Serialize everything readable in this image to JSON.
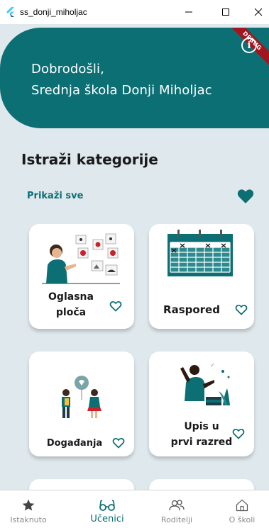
{
  "window": {
    "title": "ss_donji_miholjac"
  },
  "header": {
    "greeting_line1": "Dobrodošli,",
    "greeting_line2": "Srednja škola Donji Miholjac",
    "debug_banner": "DEBUG"
  },
  "section": {
    "title": "Istraži kategorije",
    "show_all": "Prikaži sve"
  },
  "cards": [
    {
      "label1": "Oglasna",
      "label2": "ploča"
    },
    {
      "label1": "Raspored"
    },
    {
      "label1": "Događanja"
    },
    {
      "label1": "Upis u",
      "label2": "prvi razred"
    }
  ],
  "nav": {
    "items": [
      {
        "label": "Istaknuto",
        "icon": "star-icon"
      },
      {
        "label": "Učenici",
        "icon": "glasses-icon"
      },
      {
        "label": "Roditelji",
        "icon": "people-icon"
      },
      {
        "label": "O školi",
        "icon": "home-icon"
      }
    ]
  },
  "colors": {
    "primary": "#0c6f74",
    "background": "#dfe8ec",
    "debug": "#a3161f"
  }
}
